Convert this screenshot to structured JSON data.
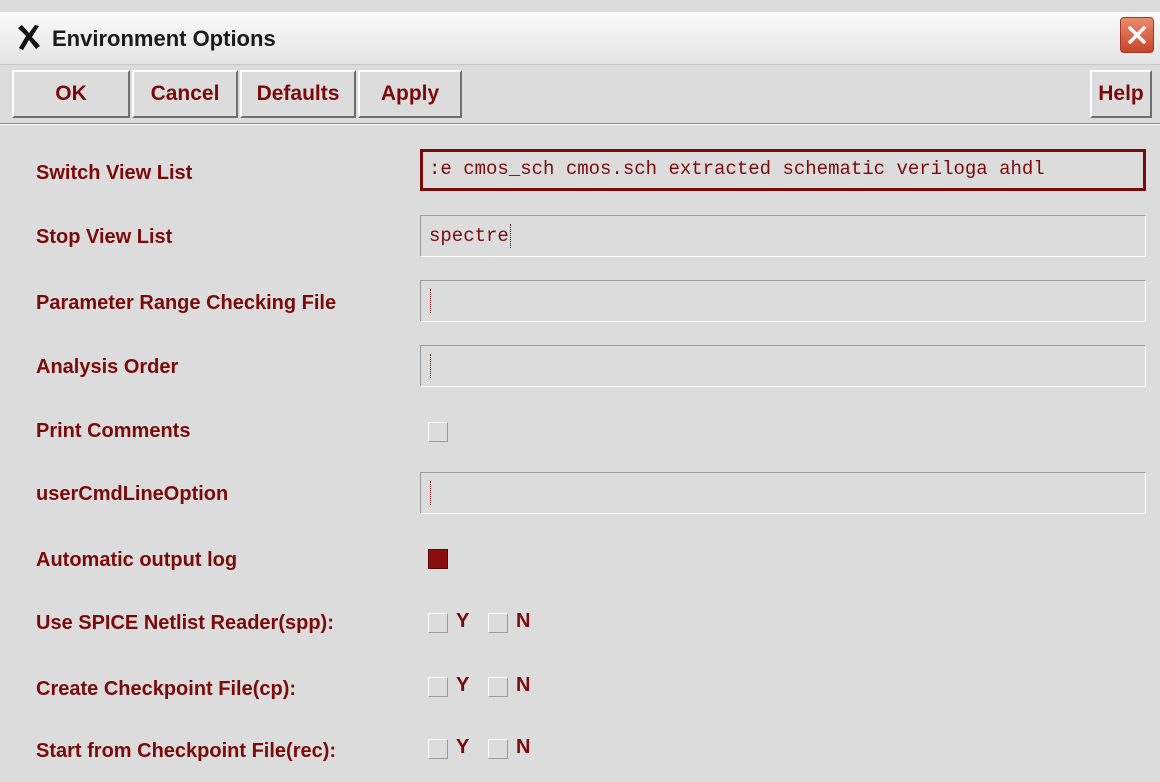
{
  "window": {
    "title": "Environment Options"
  },
  "toolbar": {
    "ok": "OK",
    "cancel": "Cancel",
    "defaults": "Defaults",
    "apply": "Apply",
    "help": "Help"
  },
  "colors": {
    "accent": "#7a0a0a",
    "background": "#dcdcdc",
    "checked": "#8b0e0e"
  },
  "icons": {
    "app": "close-x-icon",
    "close": "close-icon"
  },
  "form": {
    "switch_view_list": {
      "label": "Switch View List",
      "value": ":e cmos_sch cmos.sch extracted schematic veriloga ahdl"
    },
    "stop_view_list": {
      "label": "Stop View List",
      "value": "spectre"
    },
    "param_range_file": {
      "label": "Parameter Range Checking File",
      "value": ""
    },
    "analysis_order": {
      "label": "Analysis Order",
      "value": ""
    },
    "print_comments": {
      "label": "Print Comments",
      "checked": false
    },
    "user_cmd_line_option": {
      "label": "userCmdLineOption",
      "value": ""
    },
    "automatic_output_log": {
      "label": "Automatic output log",
      "checked": true
    },
    "use_spice_reader": {
      "label": "Use SPICE Netlist Reader(spp):",
      "y_label": "Y",
      "n_label": "N",
      "y": false,
      "n": false
    },
    "create_checkpoint": {
      "label": "Create Checkpoint File(cp):",
      "y_label": "Y",
      "n_label": "N",
      "y": false,
      "n": false
    },
    "start_from_checkpoint": {
      "label": "Start from Checkpoint File(rec):",
      "y_label": "Y",
      "n_label": "N",
      "y": false,
      "n": false
    }
  }
}
